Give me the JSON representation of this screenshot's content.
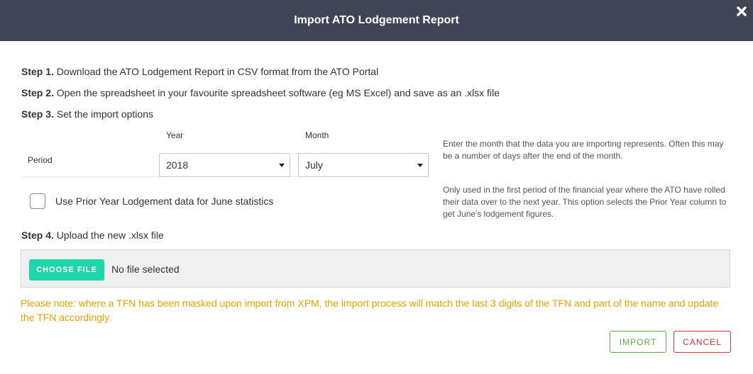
{
  "header": {
    "title": "Import ATO Lodgement Report",
    "close_icon": "close-icon"
  },
  "steps": {
    "step1_label": "Step 1.",
    "step1_text": " Download the ATO Lodgement Report in CSV format from the ATO Portal",
    "step2_label": "Step 2.",
    "step2_text": " Open the spreadsheet in your favourite spreadsheet software (eg MS Excel) and save as an .xlsx file",
    "step3_label": "Step 3.",
    "step3_text": " Set the import options",
    "step4_label": "Step 4.",
    "step4_text": " Upload the new .xlsx file"
  },
  "options": {
    "period_label": "Period",
    "year_label": "Year",
    "year_value": "2018",
    "month_label": "Month",
    "month_value": "July",
    "period_help": "Enter the month that the data you are importing represents. Often this may be a number of days after the end of the month.",
    "prior_year_label": "Use Prior Year Lodgement data for June statistics",
    "prior_year_checked": false,
    "prior_year_help": "Only used in the first period of the financial year where the ATO have rolled their data over to the next year. This option selects the Prior Year column to get June's lodgement figures."
  },
  "upload": {
    "choose_file_label": "CHOOSE FILE",
    "file_status": "No file selected"
  },
  "note": "Please note: where a TFN has been masked upon import from XPM, the import process will match the last 3 digits of the TFN and part of the name and update the TFN accordingly.",
  "actions": {
    "import_label": "IMPORT",
    "cancel_label": "CANCEL"
  },
  "colors": {
    "header_bg": "#404556",
    "choose_file_bg": "#1ed6a8",
    "note_text": "#f2a100",
    "import_accent": "#5aab4a",
    "cancel_accent": "#d9363e"
  }
}
